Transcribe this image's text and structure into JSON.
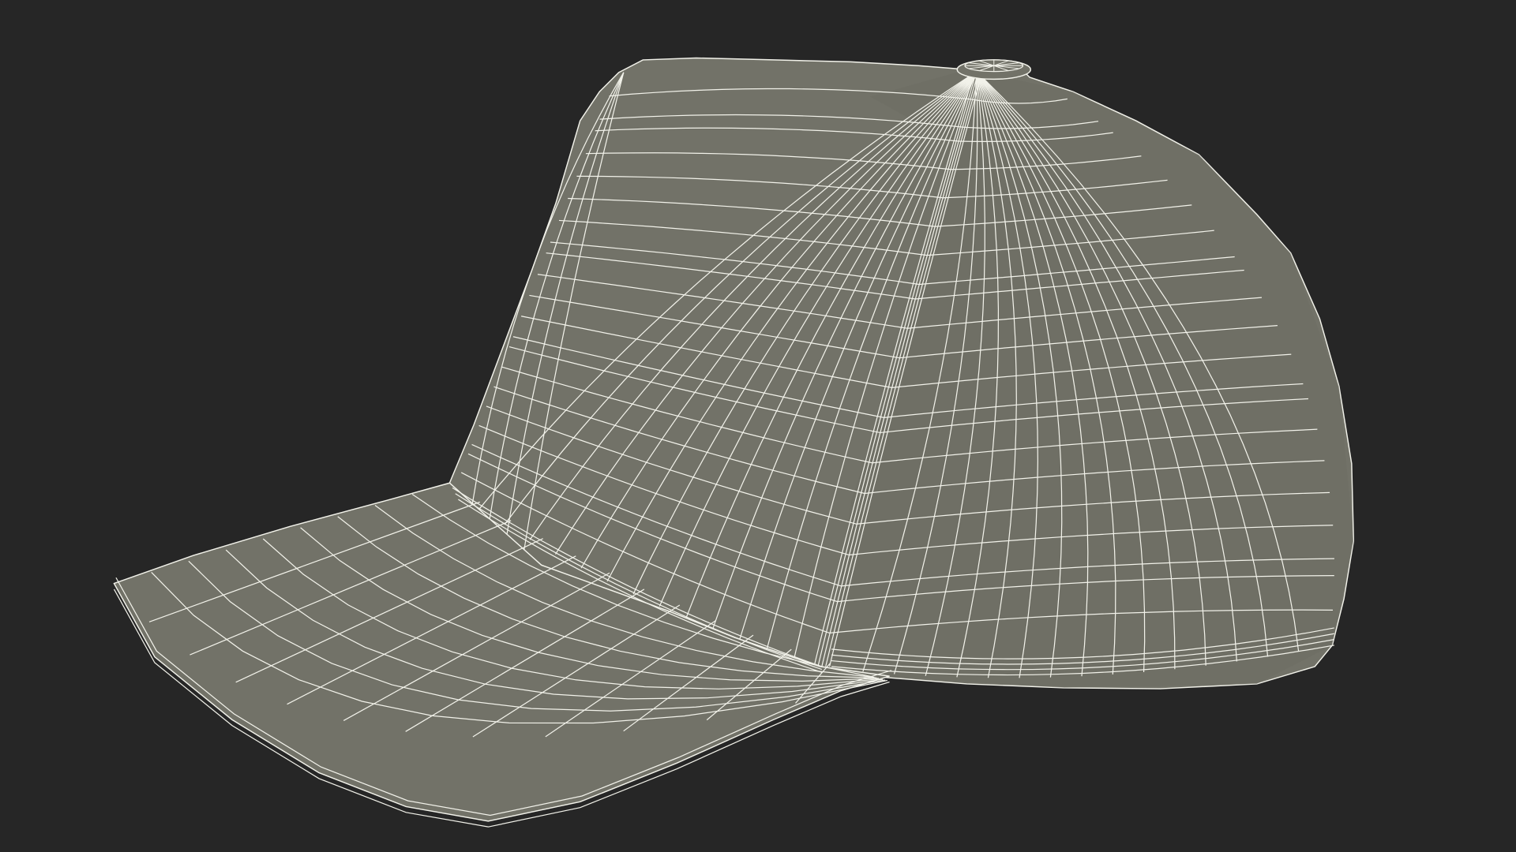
{
  "viewport": {
    "background_color": "#262626",
    "render_mode": "wireframe-on-shaded"
  },
  "model": {
    "subject": "baseball cap",
    "surface_color": "#727268",
    "surface_shade_color": "#6a6a61",
    "wire_color": "#f2f2ea"
  }
}
